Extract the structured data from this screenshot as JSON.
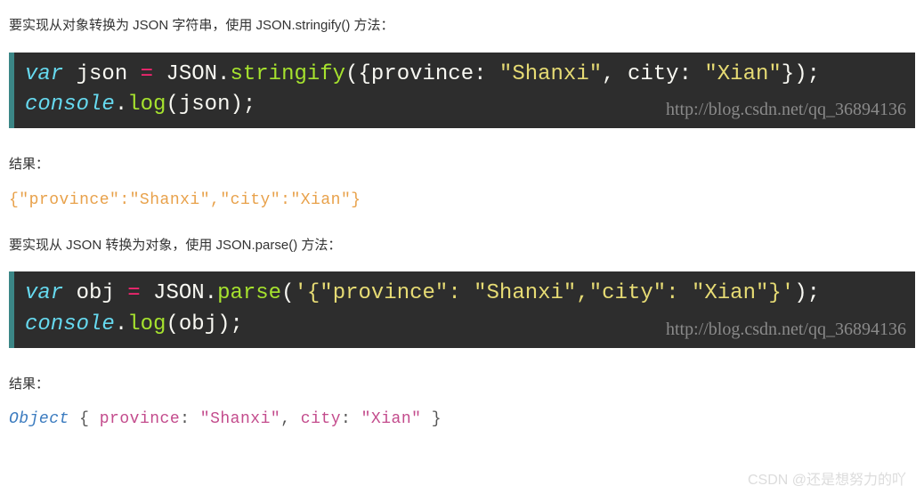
{
  "para1": "要实现从对象转换为 JSON 字符串，使用 JSON.stringify() 方法：",
  "code1": {
    "l1": {
      "kw": "var ",
      "va": "json",
      "op": " = ",
      "cls": "JSON",
      "dot": ".",
      "fn": "stringify",
      "open": "(",
      "brace": "{",
      "k1": "province",
      "c1": ": ",
      "s1": "\"Shanxi\"",
      "cm": ", ",
      "k2": "city",
      "c2": ": ",
      "s2": "\"Xian\"",
      "brace2": "}",
      "close": ")",
      "semi": ";"
    },
    "l2": {
      "obj": "console",
      "dot": ".",
      "fn": "log",
      "open": "(",
      "arg": "json",
      "close": ")",
      "semi": ";"
    },
    "wm": "http://blog.csdn.net/qq_36894136"
  },
  "resultLabel1": "结果：",
  "output1": "{\"province\":\"Shanxi\",\"city\":\"Xian\"}",
  "para2": "要实现从 JSON 转换为对象，使用 JSON.parse() 方法：",
  "code2": {
    "l1": {
      "kw": "var ",
      "va": "obj",
      "op": " = ",
      "cls": "JSON",
      "dot": ".",
      "fn": "parse",
      "open": "(",
      "str": "'{\"province\": \"Shanxi\",\"city\": \"Xian\"}'",
      "close": ")",
      "semi": ";"
    },
    "l2": {
      "obj": "console",
      "dot": ".",
      "fn": "log",
      "open": "(",
      "arg": "obj",
      "close": ")",
      "semi": ";"
    },
    "wm": "http://blog.csdn.net/qq_36894136"
  },
  "resultLabel2": "结果：",
  "output2": {
    "type": "Object ",
    "open": "{ ",
    "k1": "province",
    "c1": ": ",
    "s1": "\"Shanxi\"",
    "cm": ", ",
    "k2": "city",
    "c2": ": ",
    "s2": "\"Xian\"",
    "close": " }"
  },
  "csdnwm": "CSDN @还是想努力的吖"
}
